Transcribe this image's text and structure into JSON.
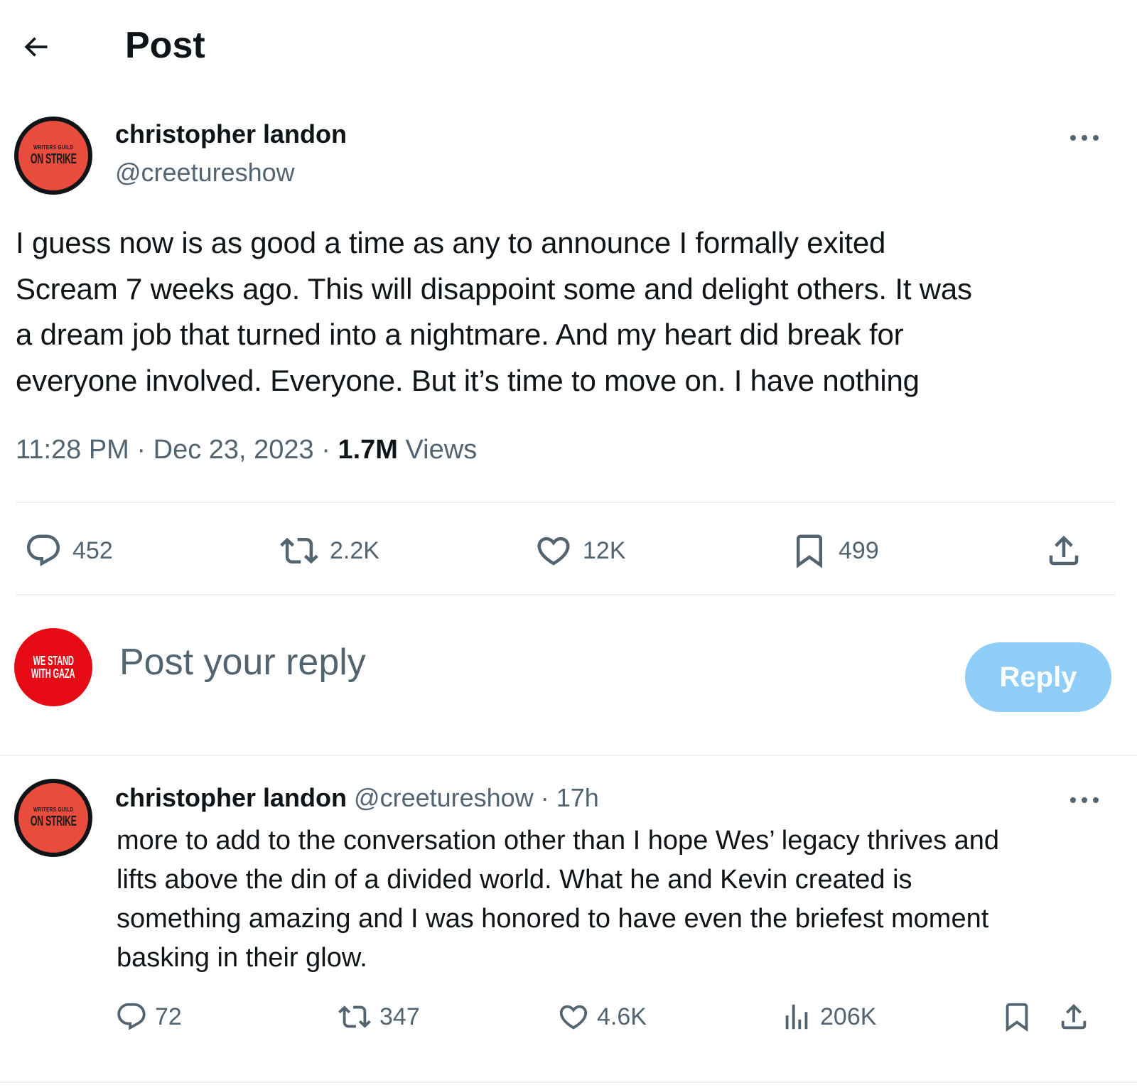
{
  "header": {
    "title": "Post"
  },
  "main_post": {
    "author_name": "christopher landon",
    "author_handle": "@creetureshow",
    "avatar_text_small": "WRITERS GUILD",
    "avatar_text_big": "ON STRIKE",
    "text_lines": [
      "I guess now is as good a time as any to announce I formally exited",
      "Scream 7 weeks ago. This will disappoint some and delight others. It was",
      "a dream job that turned into a nightmare. And my heart did break for",
      "everyone involved. Everyone. But it’s time to move on. I have nothing"
    ],
    "time": "11:28 PM",
    "separator": "·",
    "date": "Dec 23, 2023",
    "views_count": "1.7M",
    "views_label": "Views",
    "stats": {
      "replies": "452",
      "reposts": "2.2K",
      "likes": "12K",
      "bookmarks": "499"
    }
  },
  "reply_composer": {
    "avatar_line1": "WE STAND",
    "avatar_line2": "WITH GAZA",
    "placeholder": "Post your reply",
    "button_label": "Reply",
    "button_color": "#8ecdf8"
  },
  "reply_post": {
    "author_name": "christopher landon",
    "author_handle": "@creetureshow",
    "separator": "·",
    "time_ago": "17h",
    "text_lines": [
      "more to add to the conversation other than I hope Wes’ legacy thrives and",
      "lifts above the din of  a divided world. What he and Kevin created is",
      "something amazing and I was honored to have even the briefest moment",
      "basking in their glow."
    ],
    "stats": {
      "replies": "72",
      "reposts": "347",
      "likes": "4.6K",
      "views": "206K"
    }
  },
  "icons": {
    "back": "arrow-left-icon",
    "more": "more-horizontal-icon",
    "reply": "speech-bubble-icon",
    "repost": "repost-icon",
    "like": "heart-icon",
    "bookmark": "bookmark-icon",
    "share": "share-icon",
    "views": "bar-chart-icon"
  },
  "colors": {
    "text_primary": "#0f1419",
    "text_secondary": "#536471",
    "divider": "#eff3f4",
    "avatar_strike": "#e74c3c",
    "avatar_gaza": "#e60a14"
  }
}
